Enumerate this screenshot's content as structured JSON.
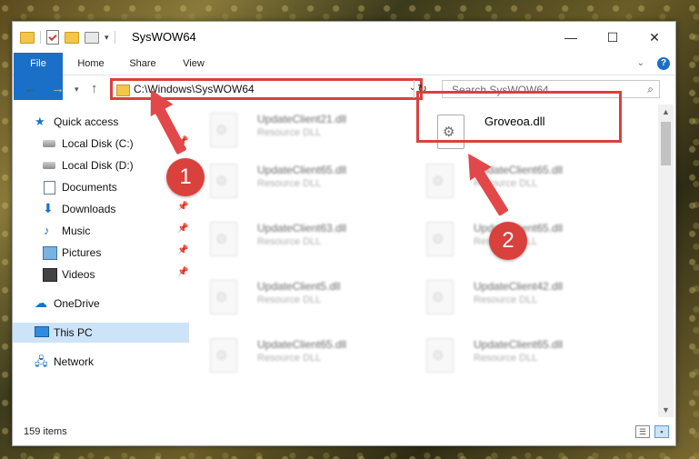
{
  "window": {
    "title": "SysWOW64",
    "controls": {
      "minimize": "—",
      "maximize": "☐",
      "close": "✕"
    }
  },
  "ribbon": {
    "tabs": [
      "File",
      "Home",
      "Share",
      "View"
    ],
    "expand_icon": "chevron-down-icon",
    "help_icon": "?"
  },
  "address_bar": {
    "path": "C:\\Windows\\SysWOW64",
    "highlight_color": "#d9413d"
  },
  "search": {
    "placeholder": "Search SysWOW64"
  },
  "nav_pane": {
    "items": [
      {
        "label": "Quick access",
        "icon": "star-icon"
      },
      {
        "label": "Local Disk (C:)",
        "icon": "drive-icon",
        "pinned": true
      },
      {
        "label": "Local Disk (D:)",
        "icon": "drive-icon"
      },
      {
        "label": "Documents",
        "icon": "document-icon",
        "pinned": true
      },
      {
        "label": "Downloads",
        "icon": "download-icon",
        "pinned": true
      },
      {
        "label": "Music",
        "icon": "music-icon",
        "pinned": true
      },
      {
        "label": "Pictures",
        "icon": "picture-icon",
        "pinned": true
      },
      {
        "label": "Videos",
        "icon": "video-icon",
        "pinned": true
      },
      {
        "label": "OneDrive",
        "icon": "cloud-icon"
      },
      {
        "label": "This PC",
        "icon": "computer-icon",
        "selected": true
      },
      {
        "label": "Network",
        "icon": "network-icon"
      }
    ]
  },
  "files": {
    "column1": [
      {
        "name": "UpdateClient21.dll",
        "type": "Resource DLL"
      },
      {
        "name": "UpdateClient65.dll",
        "type": "Resource DLL"
      },
      {
        "name": "UpdateClient63.dll",
        "type": "Resource DLL"
      },
      {
        "name": "UpdateClient5.dll",
        "type": "Resource DLL"
      },
      {
        "name": "UpdateClient65.dll",
        "type": "Resource DLL"
      }
    ],
    "column2": [
      {
        "name": "Groveoa.dll",
        "type": ""
      },
      {
        "name": "UpdateClient65.dll",
        "type": "Resource DLL"
      },
      {
        "name": "UpdateClient65.dll",
        "type": "Resource DLL"
      },
      {
        "name": "UpdateClient42.dll",
        "type": "Resource DLL"
      },
      {
        "name": "UpdateClient65.dll",
        "type": "Resource DLL"
      }
    ]
  },
  "status": {
    "item_count": "159 items"
  },
  "annotations": {
    "step1": "1",
    "step2": "2",
    "color": "#d9413d"
  }
}
